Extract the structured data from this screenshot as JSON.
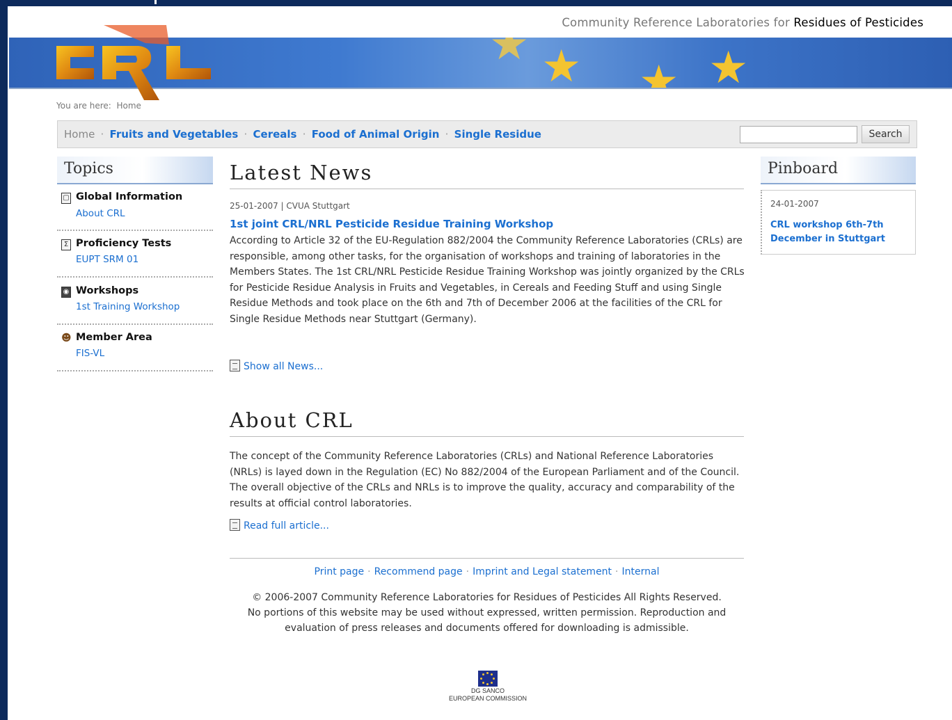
{
  "header": {
    "tagline_prefix": "Community Reference Laboratories for",
    "tagline_strong": "Residues of Pesticides",
    "logo_text": "CRL"
  },
  "breadcrumb": {
    "label": "You are here:",
    "current": "Home"
  },
  "nav": {
    "home": "Home",
    "items": [
      "Fruits and Vegetables",
      "Cereals",
      "Food of Animal Origin",
      "Single Residue"
    ],
    "separator": "·",
    "search_placeholder": "",
    "search_button": "Search"
  },
  "topics": {
    "title": "Topics",
    "items": [
      {
        "title": "Global Information",
        "link": "About CRL",
        "icon": "document-icon"
      },
      {
        "title": "Proficiency Tests",
        "link": "EUPT SRM 01",
        "icon": "sigma-document-icon"
      },
      {
        "title": "Workshops",
        "link": "1st Training Workshop",
        "icon": "workshop-icon"
      },
      {
        "title": "Member Area",
        "link": "FIS-VL",
        "icon": "members-icon"
      }
    ]
  },
  "news": {
    "heading": "Latest News",
    "meta": "25-01-2007 | CVUA Stuttgart",
    "title": "1st joint CRL/NRL Pesticide Residue Training Workshop",
    "body": "According to Article 32 of the EU-Regulation 882/2004 the Community Reference Laboratories (CRLs) are responsible, among other tasks, for the organisation of workshops and training of laboratories in the Members States. The 1st CRL/NRL Pesticide Residue Training Workshop was jointly organized by the CRLs for Pesticide Residue Analysis in Fruits and Vegetables, in Cereals and Feeding Stuff and using Single Residue Methods and took place on the 6th and 7th of December 2006 at the facilities of the CRL for Single Residue Methods near Stuttgart (Germany).",
    "show_all": "Show all News..."
  },
  "about": {
    "heading": "About CRL",
    "body": "The concept of the Community Reference Laboratories (CRLs) and National Reference Laboratories (NRLs) is layed down in the Regulation (EC) No 882/2004 of the European Parliament and of the Council. The overall objective of the CRLs and NRLs is to improve the quality, accuracy and comparability of the results at official control laboratories.",
    "read_more": "Read full article..."
  },
  "footer": {
    "links": [
      "Print page",
      "Recommend page",
      "Imprint and Legal statement",
      "Internal"
    ],
    "separator": "·",
    "copyright_1": "© 2006-2007 Community Reference Laboratories for Residues of Pesticides All Rights Reserved.",
    "copyright_2": "No portions of this website may be used without expressed, written permission. Reproduction and",
    "copyright_3": "evaluation of press releases and documents offered for downloading is admissible.",
    "logo_line_1": "DG SANCO",
    "logo_line_2": "EUROPEAN COMMISSION"
  },
  "pinboard": {
    "title": "Pinboard",
    "date": "24-01-2007",
    "link": "CRL workshop 6th-7th December in Stuttgart"
  },
  "colors": {
    "frame": "#0d2a5c",
    "link": "#1b6fd0",
    "banner": "#3f7ad0",
    "star": "#f4c430"
  }
}
